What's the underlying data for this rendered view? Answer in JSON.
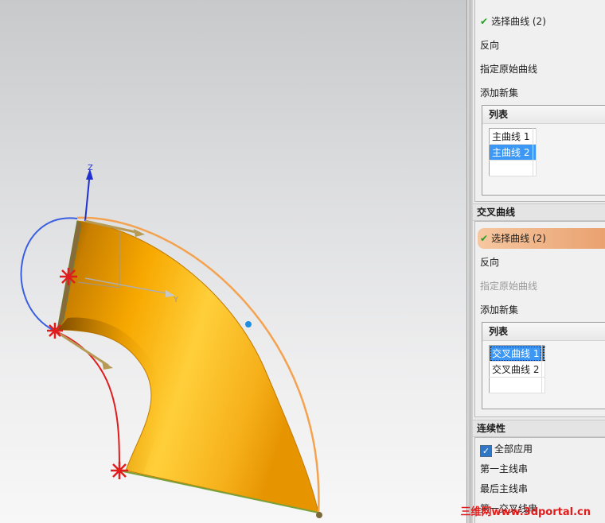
{
  "viewport": {
    "axis_z_label": "Z",
    "axis_y_label": "Y"
  },
  "primary_curves": {
    "select_label": "选择曲线 (2)",
    "reverse_label": "反向",
    "specify_origin_label": "指定原始曲线",
    "add_new_set_label": "添加新集",
    "list_title": "列表",
    "items": [
      "主曲线 1",
      "主曲线 2"
    ]
  },
  "cross_curves": {
    "header": "交叉曲线",
    "select_label": "选择曲线 (2)",
    "reverse_label": "反向",
    "specify_origin_label": "指定原始曲线",
    "add_new_set_label": "添加新集",
    "list_title": "列表",
    "items": [
      "交叉曲线 1",
      "交叉曲线 2"
    ]
  },
  "continuity": {
    "header": "连续性",
    "apply_all_label": "全部应用",
    "apply_all_checked": true,
    "first_primary_label": "第一主线串",
    "last_primary_label": "最后主线串",
    "first_cross_label": "第一交叉线串"
  },
  "watermark": "三维网www.3dportal.cn",
  "colors": {
    "surface": "#f5a400",
    "selection_blue": "#3d98f5",
    "active_row": "#e9a06d",
    "curve_red": "#e01c1c",
    "curve_blue": "#3a5fe0",
    "curve_orange": "#f4a24f"
  }
}
